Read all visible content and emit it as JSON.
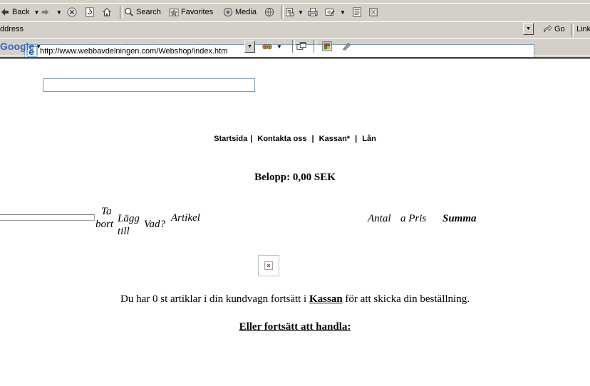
{
  "toolbar": {
    "back_label": "Back",
    "search_label": "Search",
    "favorites_label": "Favorites",
    "media_label": "Media"
  },
  "address": {
    "label": "ddress",
    "url": "http://www.webbavdelningen.com/Webshop/index.htm",
    "go_label": "Go",
    "links_label": "Link"
  },
  "google": {
    "logo": "Google",
    "search_value": ""
  },
  "nav": {
    "items": [
      "Startsida",
      "Kontakta oss",
      "Kassan*",
      "Lån"
    ],
    "separator": "|"
  },
  "summary": {
    "amount_text": "Belopp: 0,00 SEK"
  },
  "cart_headers": {
    "remove_line1": "Ta",
    "remove_line2": "bort",
    "add_line1": "Lägg",
    "add_line2": "till",
    "what": "Vad?",
    "article": "Artikel",
    "qty": "Antal",
    "unit_price": "a Pris",
    "total": "Summa"
  },
  "message": {
    "before": "Du har 0 st artiklar i din kundvagn fortsätt i ",
    "link": "Kassan",
    "after": " för att skicka din beställning."
  },
  "continue_text": "Eller fortsätt att handla:",
  "colors": {
    "chrome": "#d4d0c8",
    "ie_blue": "#1c5fb4",
    "google_blue": "#3366cc",
    "google_red": "#d52b1e",
    "google_yellow": "#f4b400",
    "google_green": "#2a9a45"
  }
}
